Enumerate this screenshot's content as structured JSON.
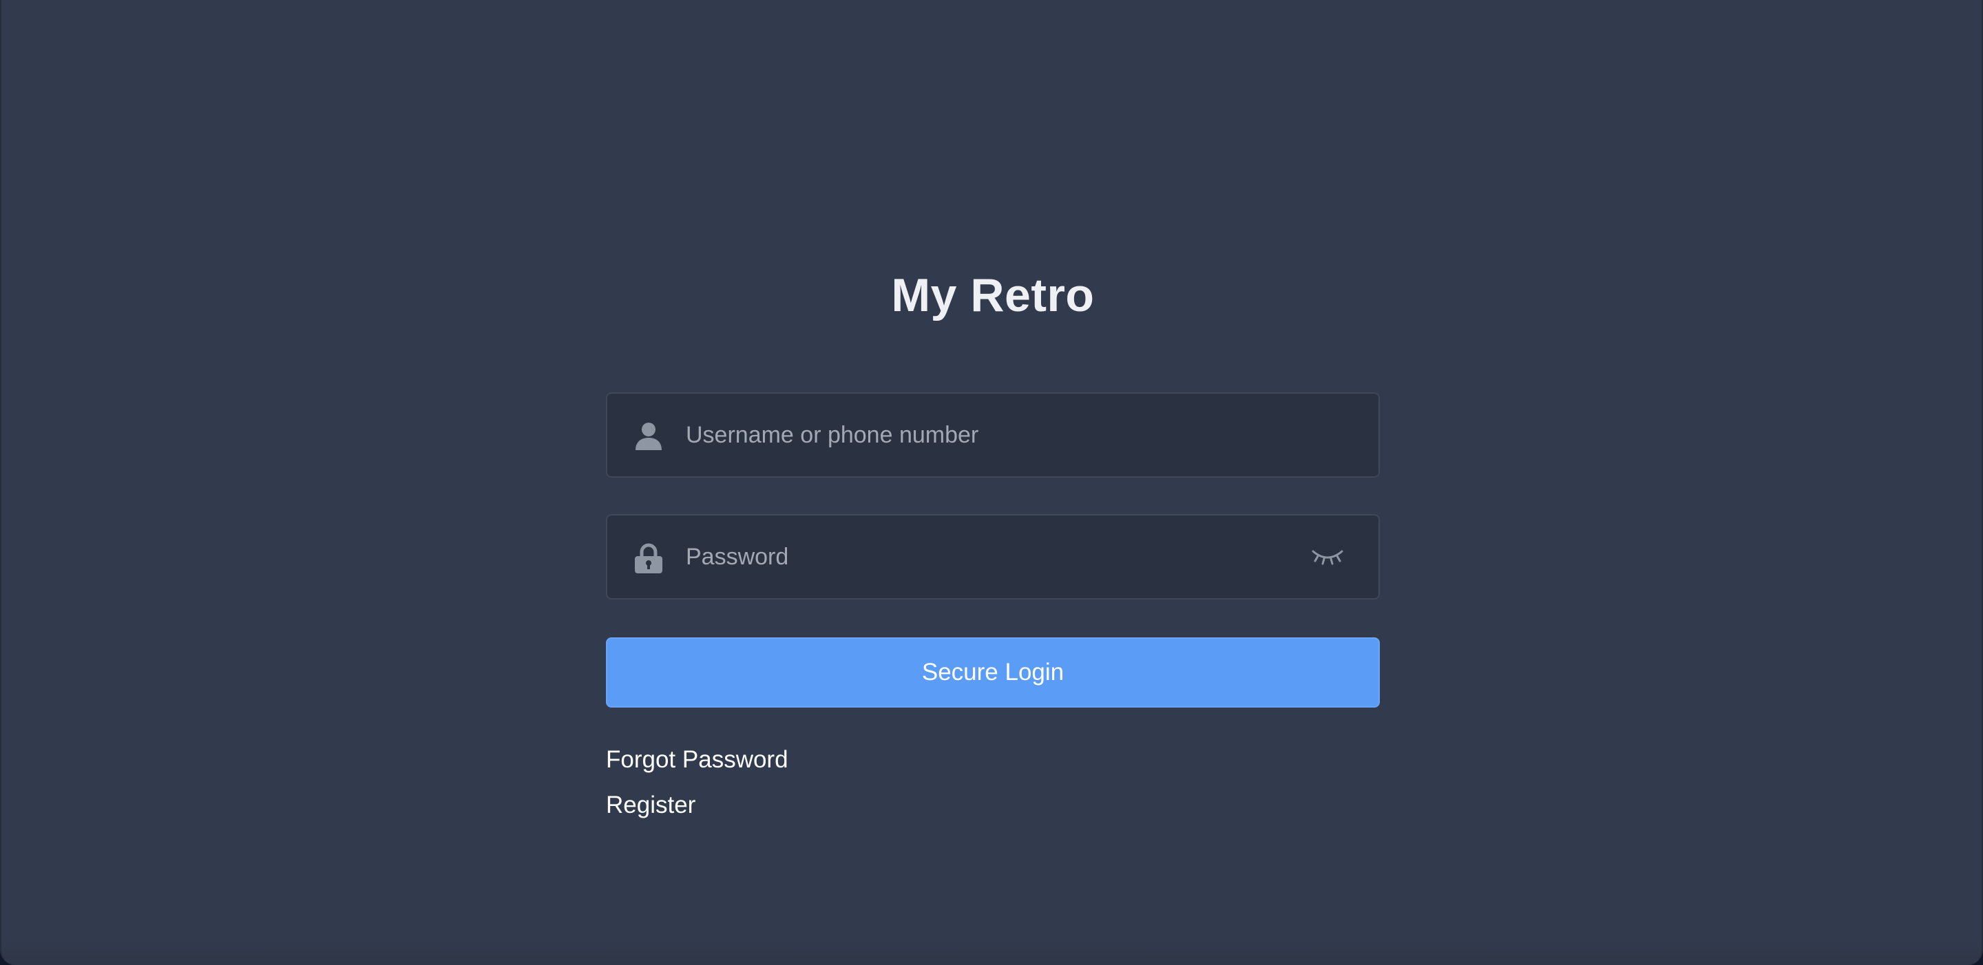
{
  "app": {
    "title": "My Retro"
  },
  "login_form": {
    "username": {
      "placeholder": "Username or phone number",
      "value": "",
      "icon": "user-icon"
    },
    "password": {
      "placeholder": "Password",
      "value": "",
      "icon": "lock-icon",
      "visibility_icon": "eye-closed-icon"
    },
    "submit_label": "Secure Login"
  },
  "links": {
    "forgot_password": "Forgot Password",
    "register": "Register"
  },
  "colors": {
    "background": "#323b4d",
    "field_background": "#2a3242",
    "field_border": "#3f4859",
    "accent": "#5b9cf6",
    "title_text": "#eef0f4",
    "placeholder_text": "#a3a9b4",
    "icon": "#8f96a3"
  }
}
